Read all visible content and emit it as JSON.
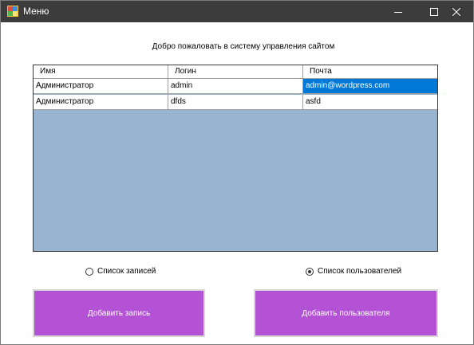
{
  "window": {
    "title": "Меню",
    "controls": {
      "minimize": "minimize-icon",
      "maximize": "maximize-icon",
      "close": "close-icon"
    }
  },
  "welcome_text": "Добро пожаловать в систему управления сайтом",
  "table": {
    "columns": [
      "Имя",
      "Логин",
      "Почта"
    ],
    "rows": [
      [
        "Администратор",
        "admin",
        "admin@wordpress.com"
      ],
      [
        "Администратор",
        "dfds",
        "asfd"
      ]
    ],
    "selected_cell": {
      "row": 0,
      "column": 2
    }
  },
  "radios": [
    {
      "label": "Список записей",
      "checked": false
    },
    {
      "label": "Список пользователей",
      "checked": true
    }
  ],
  "buttons": {
    "add_record": "Добавить запись",
    "add_user": "Добавить пользователя"
  },
  "colors": {
    "titlebar": "#3c3c3c",
    "grid_background": "#99b4d1",
    "selection": "#0078d7",
    "button": "#b352d4"
  }
}
